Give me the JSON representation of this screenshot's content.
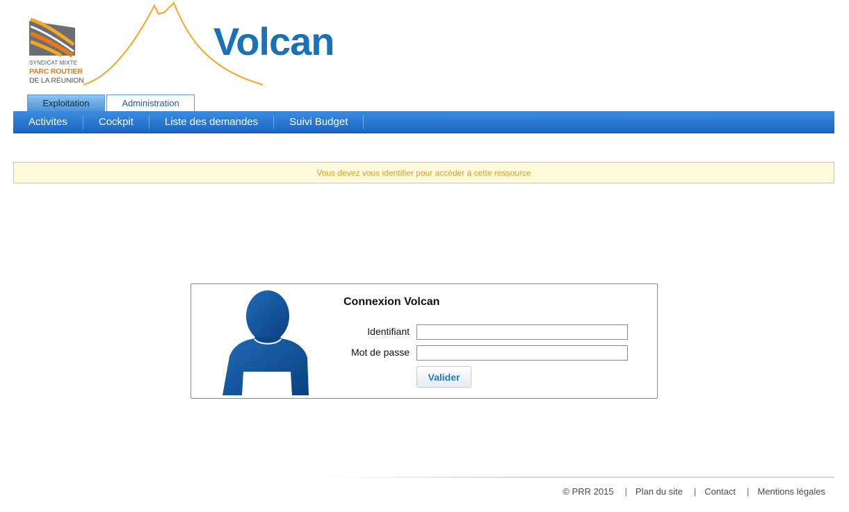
{
  "brand": {
    "org_line1": "SYNDICAT MIXTE",
    "org_line2": "PARC ROUTIER",
    "org_line3": "DE LA RÉUNION",
    "app_name": "Volcan",
    "colors": {
      "app_name": "#1a72b6",
      "accent_orange": "#f5a623",
      "nav_blue": "#1a66c2"
    }
  },
  "tabs": [
    {
      "label": "Exploitation",
      "active": true
    },
    {
      "label": "Administration",
      "active": false
    }
  ],
  "nav": [
    {
      "label": "Activites"
    },
    {
      "label": "Cockpit"
    },
    {
      "label": "Liste des demandes"
    },
    {
      "label": "Suivi Budget"
    }
  ],
  "alert": {
    "message": "Vous devez vous identifier pour accéder à cette ressource"
  },
  "login": {
    "title": "Connexion Volcan",
    "username_label": "Identifiant",
    "username_value": "",
    "password_label": "Mot de passe",
    "password_value": "",
    "submit_label": "Valider",
    "avatar_icon": "user-silhouette-icon"
  },
  "footer": {
    "copyright": "© PRR 2015",
    "links": [
      "Plan du site",
      "Contact",
      "Mentions légales"
    ]
  }
}
